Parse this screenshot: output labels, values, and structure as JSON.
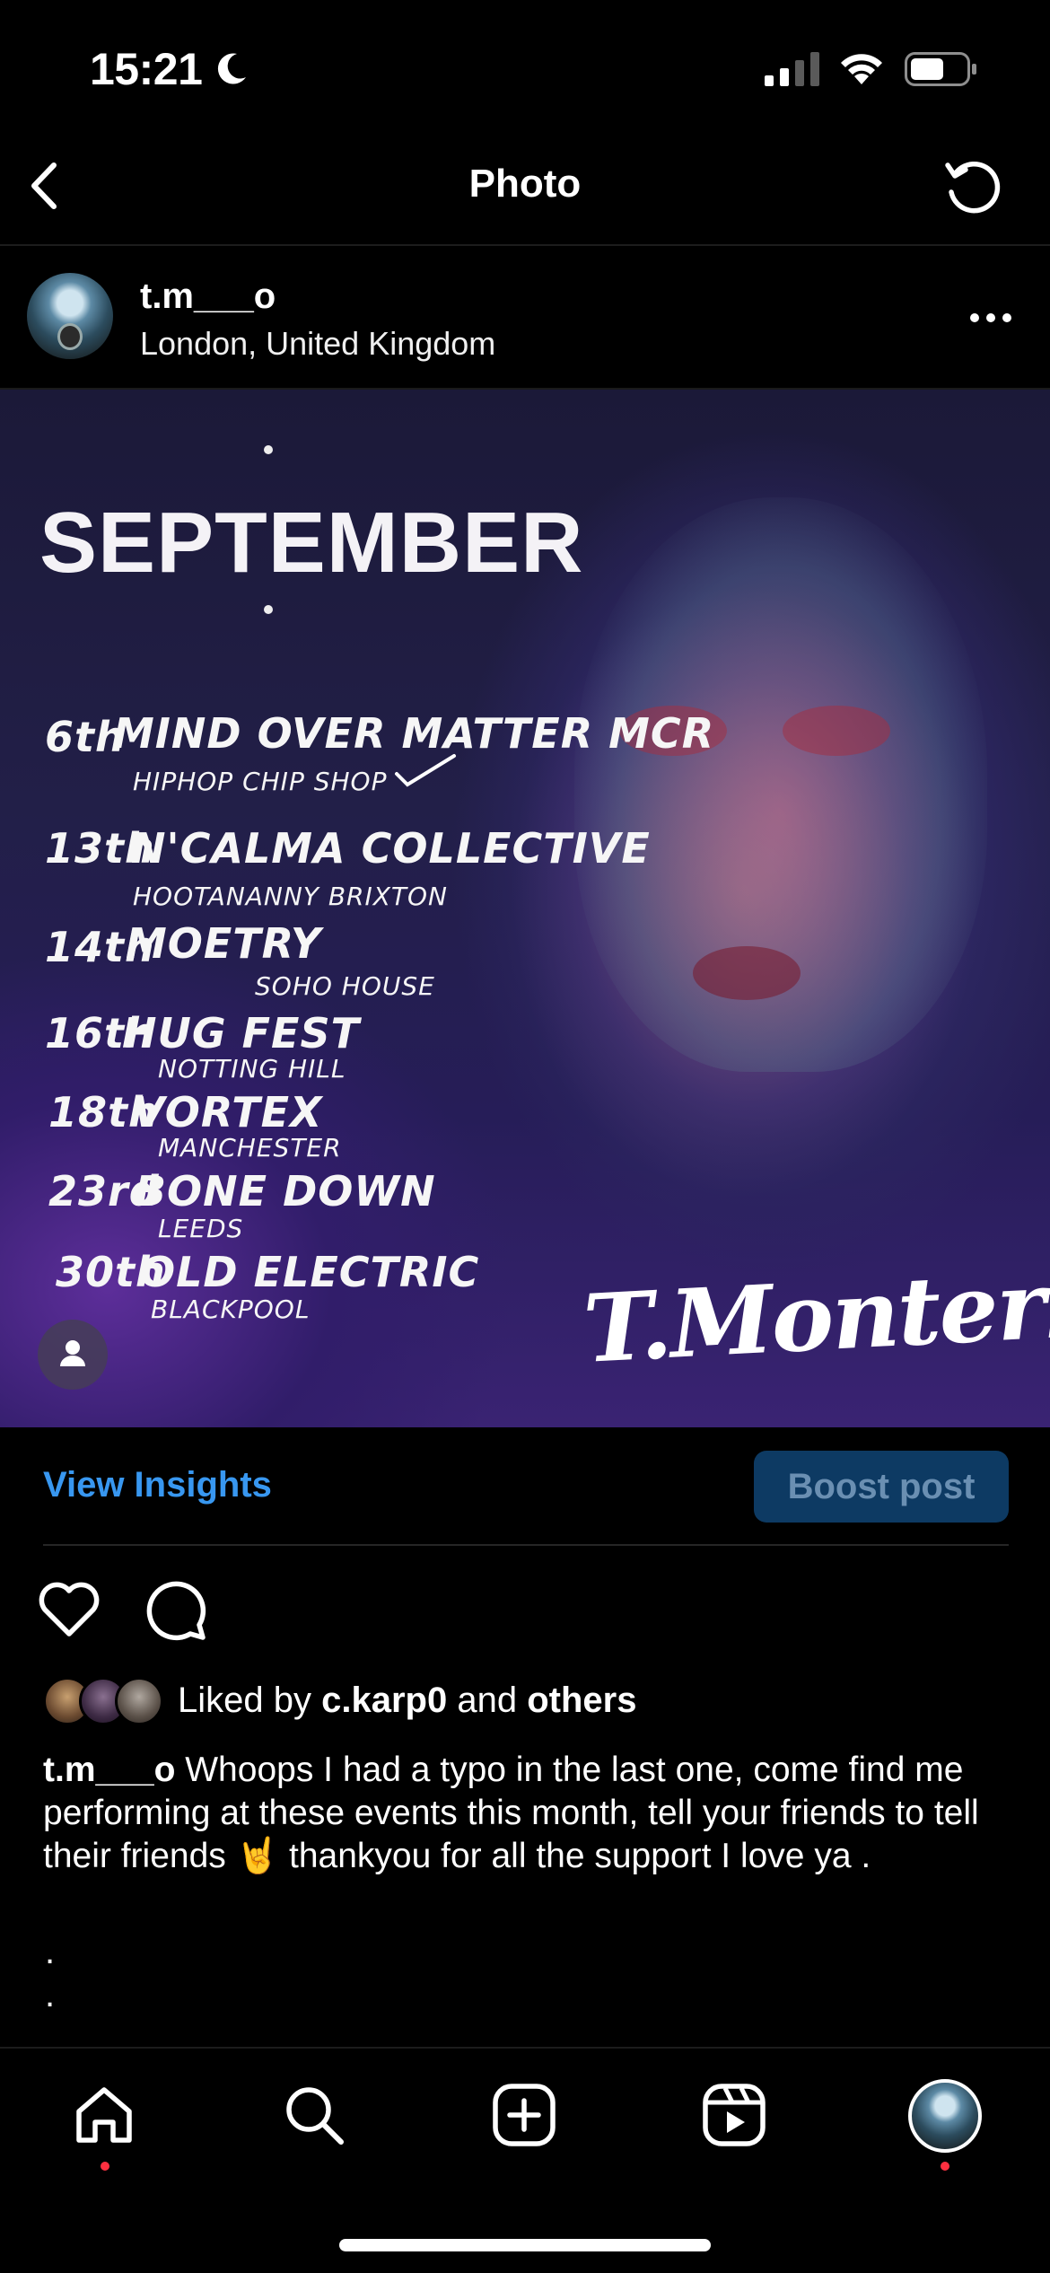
{
  "status_bar": {
    "time": "15:21"
  },
  "header": {
    "title": "Photo"
  },
  "post": {
    "username": "t.m___o",
    "location": "London, United Kingdom",
    "poster": {
      "month": "SEPTEMBER",
      "events": [
        {
          "date": "6th",
          "name": "MIND OVER MATTER  MCR",
          "venue": "HIPHOP CHIP SHOP"
        },
        {
          "date": "13th",
          "name": "N'CALMA COLLECTIVE",
          "venue": "HOOTANANNY BRIXTON"
        },
        {
          "date": "14th",
          "name": "MOETRY",
          "venue": "SOHO HOUSE"
        },
        {
          "date": "16th",
          "name": "HUG FEST",
          "venue": "NOTTING HILL"
        },
        {
          "date": "18th",
          "name": "VORTEX",
          "venue": "MANCHESTER"
        },
        {
          "date": "23rd",
          "name": "BONE DOWN",
          "venue": "LEEDS"
        },
        {
          "date": "30th",
          "name": "OLD ELECTRIC",
          "venue": "BLACKPOOL"
        }
      ],
      "signature": "T.Monterisi"
    }
  },
  "insights": {
    "view_label": "View Insights",
    "boost_label": "Boost post"
  },
  "likes": {
    "prefix": "Liked by ",
    "user": "c.karp0",
    "middle": " and ",
    "others": "others"
  },
  "caption": {
    "username": "t.m___o",
    "text": "Whoops I had a typo in the last one, come find me performing at these events this month, tell your friends to tell their friends 🤘 thankyou for all the support I love ya .",
    "dot1": ".",
    "dot2": "."
  },
  "tabs": [
    "home-icon",
    "search-icon",
    "create-icon",
    "reels-icon",
    "profile-avatar"
  ]
}
